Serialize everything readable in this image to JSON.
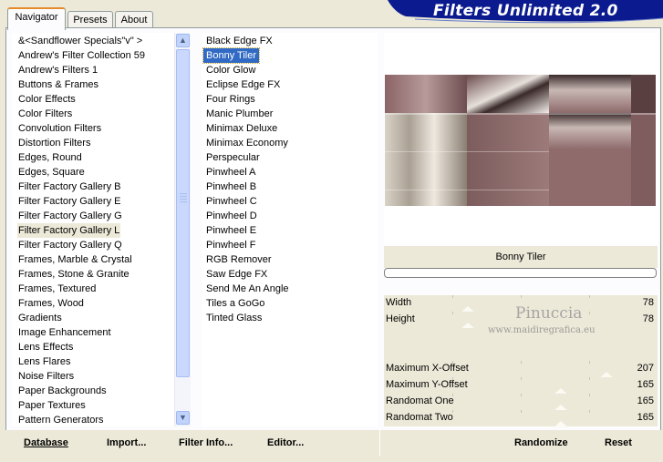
{
  "title": "Filters Unlimited 2.0",
  "tabs": [
    {
      "label": "Navigator",
      "active": true
    },
    {
      "label": "Presets",
      "active": false
    },
    {
      "label": "About",
      "active": false
    }
  ],
  "categories": [
    "&<Sandflower Specials\"v\" >",
    "Andrew's Filter Collection 59",
    "Andrew's Filters 1",
    "Buttons & Frames",
    "Color Effects",
    "Color Filters",
    "Convolution Filters",
    "Distortion Filters",
    "Edges, Round",
    "Edges, Square",
    "Filter Factory Gallery B",
    "Filter Factory Gallery E",
    "Filter Factory Gallery G",
    "Filter Factory Gallery L",
    "Filter Factory Gallery Q",
    "Frames, Marble & Crystal",
    "Frames, Stone & Granite",
    "Frames, Textured",
    "Frames, Wood",
    "Gradients",
    "Image Enhancement",
    "Lens Effects",
    "Lens Flares",
    "Noise Filters",
    "Paper Backgrounds",
    "Paper Textures",
    "Pattern Generators"
  ],
  "selected_category": "Filter Factory Gallery L",
  "filters": [
    "Black Edge FX",
    "Bonny Tiler",
    "Color Glow",
    "Eclipse Edge FX",
    "Four Rings",
    "Manic Plumber",
    "Minimax Deluxe",
    "Minimax Economy",
    "Perspecular",
    "Pinwheel A",
    "Pinwheel B",
    "Pinwheel C",
    "Pinwheel D",
    "Pinwheel E",
    "Pinwheel F",
    "RGB Remover",
    "Saw Edge FX",
    "Send Me An Angle",
    "Tiles a GoGo",
    "Tinted Glass"
  ],
  "selected_filter": "Bonny Tiler",
  "current_filter_name": "Bonny Tiler",
  "params": [
    {
      "label": "Width",
      "value": "78",
      "slider": 0.306
    },
    {
      "label": "Height",
      "value": "78",
      "slider": 0.306
    },
    {
      "label": "",
      "value": "",
      "slider": null
    },
    {
      "label": "",
      "value": "",
      "slider": null
    },
    {
      "label": "Maximum X-Offset",
      "value": "207",
      "slider": 0.812
    },
    {
      "label": "Maximum Y-Offset",
      "value": "165",
      "slider": 0.647
    },
    {
      "label": "Randomat One",
      "value": "165",
      "slider": 0.647
    },
    {
      "label": "Randomat Two",
      "value": "165",
      "slider": 0.647
    }
  ],
  "watermark": {
    "line1": "Pinuccia",
    "line2": "www.maidiregrafica.eu"
  },
  "buttons": {
    "database": "Database",
    "import": "Import...",
    "filter_info": "Filter Info...",
    "editor": "Editor...",
    "randomize": "Randomize",
    "reset": "Reset"
  },
  "colors": {
    "banner": "#0b1b8f",
    "selection": "#316ac5",
    "tab_highlight": "#e68b2c"
  },
  "icons": {
    "scroll_up": "▲",
    "scroll_down": "▼",
    "grip": "≡"
  }
}
